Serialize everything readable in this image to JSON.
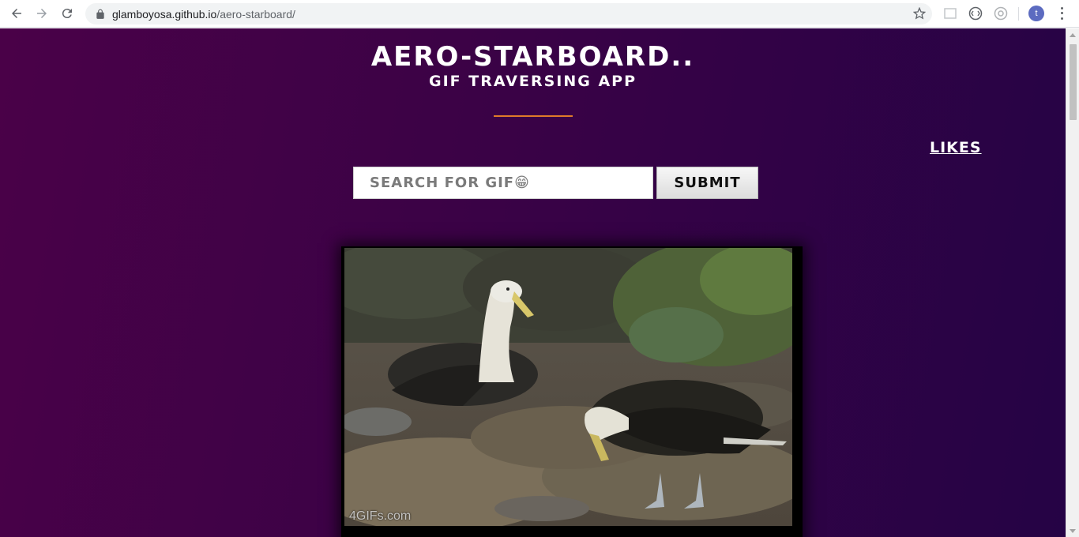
{
  "browser": {
    "url_domain": "glamboyosa.github.io",
    "url_path": "/aero-starboard/",
    "profile_initial": "t"
  },
  "app": {
    "title": "Aero-Starboard..",
    "subtitle": "GIF Traversing App",
    "likes_link": "Likes",
    "search_placeholder": "SEARCH FOR GIF😁",
    "submit_label": "Submit",
    "gif_watermark": "4GIFs.com"
  },
  "colors": {
    "background_start": "#4a0148",
    "background_end": "#250345",
    "accent_line": "#e07a2a"
  }
}
